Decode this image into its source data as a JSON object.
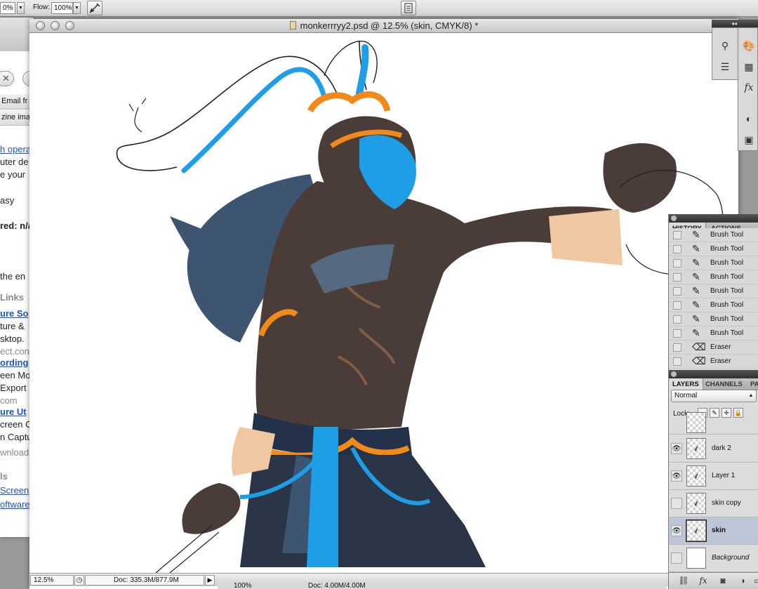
{
  "options_bar": {
    "opacity_value": "0%",
    "flow_label": "Flow:",
    "flow_value": "100%"
  },
  "browser": {
    "strip1": "Email fr",
    "strip2": "zine ima",
    "lines": [
      {
        "text": "h opera",
        "style": "link"
      },
      {
        "text": "uter de",
        "style": "plain"
      },
      {
        "text": "e your",
        "style": "plain"
      },
      {
        "text": "asy",
        "style": "plain"
      },
      {
        "text": "red: n/a",
        "style": "bold"
      },
      {
        "text": "the en",
        "style": "plain"
      },
      {
        "text": "Links",
        "style": "heading"
      },
      {
        "text": "ure So",
        "style": "blue-bold"
      },
      {
        "text": "ture &",
        "style": "plain"
      },
      {
        "text": "sktop.",
        "style": "plain"
      },
      {
        "text": "ect.con",
        "style": "grey"
      },
      {
        "text": "ording",
        "style": "blue-bold"
      },
      {
        "text": "een Mov",
        "style": "plain"
      },
      {
        "text": "Export",
        "style": "plain"
      },
      {
        "text": "com",
        "style": "grey"
      },
      {
        "text": "ure Ut",
        "style": "blue-bold"
      },
      {
        "text": "creen C",
        "style": "plain"
      },
      {
        "text": "n Captu",
        "style": "plain"
      },
      {
        "text": "wnloads",
        "style": "grey"
      },
      {
        "text": "ls",
        "style": "heading"
      },
      {
        "text": "Screen",
        "style": "link"
      },
      {
        "text": "oftware",
        "style": "link"
      }
    ]
  },
  "document": {
    "title": "monkerrryy2.psd @ 12.5% (skin, CMYK/8) *",
    "zoom": "12.5%",
    "doc_size": "Doc: 335.3M/877.9M"
  },
  "back_window": {
    "zoom": "100%",
    "doc_size": "Doc: 4.00M/4.00M"
  },
  "history_panel": {
    "tabs": [
      "HISTORY",
      "ACTIONS"
    ],
    "items": [
      {
        "label": "Brush Tool",
        "icon": "brush-icon"
      },
      {
        "label": "Brush Tool",
        "icon": "brush-icon"
      },
      {
        "label": "Brush Tool",
        "icon": "brush-icon"
      },
      {
        "label": "Brush Tool",
        "icon": "brush-icon"
      },
      {
        "label": "Brush Tool",
        "icon": "brush-icon"
      },
      {
        "label": "Brush Tool",
        "icon": "brush-icon"
      },
      {
        "label": "Brush Tool",
        "icon": "brush-icon"
      },
      {
        "label": "Brush Tool",
        "icon": "brush-icon"
      },
      {
        "label": "Eraser",
        "icon": "eraser-icon"
      },
      {
        "label": "Eraser",
        "icon": "eraser-icon"
      }
    ]
  },
  "layers_panel": {
    "tabs": [
      "LAYERS",
      "CHANNELS",
      "PA"
    ],
    "blend_mode": "Normal",
    "lock_label": "Lock:",
    "layers": [
      {
        "name": "dark 2",
        "visible": true,
        "selected": false
      },
      {
        "name": "Layer 1",
        "visible": true,
        "selected": false
      },
      {
        "name": "skin copy",
        "visible": false,
        "selected": false
      },
      {
        "name": "skin",
        "visible": true,
        "selected": true
      },
      {
        "name": "Background",
        "visible": false,
        "selected": false
      }
    ]
  },
  "colors": {
    "skin_dark": "#4a3c38",
    "fur_blue": "#1e9ee6",
    "gold": "#f08a1a",
    "cloth_navy": "#23324a",
    "bandage": "#efc7a0"
  }
}
